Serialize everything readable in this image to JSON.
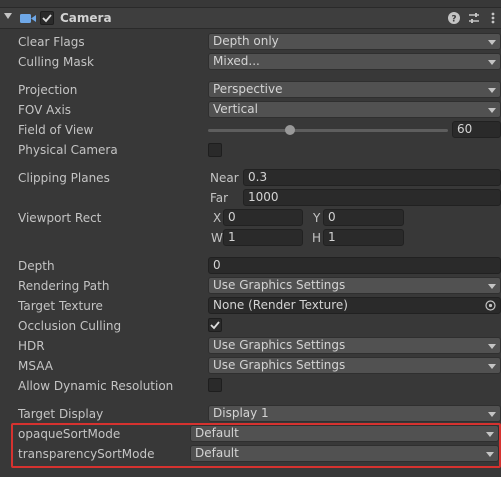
{
  "component": {
    "title": "Camera",
    "enabled": true
  },
  "rows": {
    "clear_flags": {
      "label": "Clear Flags",
      "value": "Depth only"
    },
    "culling_mask": {
      "label": "Culling Mask",
      "value": "Mixed..."
    },
    "projection": {
      "label": "Projection",
      "value": "Perspective"
    },
    "fov_axis": {
      "label": "FOV Axis",
      "value": "Vertical"
    },
    "field_of_view": {
      "label": "Field of View",
      "value": "60"
    },
    "physical_camera": {
      "label": "Physical Camera",
      "checked": false
    },
    "clipping_planes": {
      "label": "Clipping Planes",
      "near_label": "Near",
      "near_value": "0.3",
      "far_label": "Far",
      "far_value": "1000"
    },
    "viewport_rect": {
      "label": "Viewport Rect",
      "x_label": "X",
      "x_value": "0",
      "y_label": "Y",
      "y_value": "0",
      "w_label": "W",
      "w_value": "1",
      "h_label": "H",
      "h_value": "1"
    },
    "depth": {
      "label": "Depth",
      "value": "0"
    },
    "rendering_path": {
      "label": "Rendering Path",
      "value": "Use Graphics Settings"
    },
    "target_texture": {
      "label": "Target Texture",
      "value": "None (Render Texture)"
    },
    "occlusion_culling": {
      "label": "Occlusion Culling",
      "checked": true
    },
    "hdr": {
      "label": "HDR",
      "value": "Use Graphics Settings"
    },
    "msaa": {
      "label": "MSAA",
      "value": "Use Graphics Settings"
    },
    "allow_dynamic_resolution": {
      "label": "Allow Dynamic Resolution",
      "checked": false
    },
    "target_display": {
      "label": "Target Display",
      "value": "Display 1"
    },
    "opaque_sort_mode": {
      "label": "opaqueSortMode",
      "value": "Default"
    },
    "transparency_sort_mode": {
      "label": "transparencySortMode",
      "value": "Default"
    }
  },
  "icons": {
    "foldout": "chevron-down-icon",
    "camera": "camera-icon",
    "help": "help-icon",
    "presets": "presets-icon",
    "menu": "kebab-menu-icon",
    "object_picker": "target-icon",
    "check": "checkmark-icon"
  },
  "colors": {
    "background": "#383838",
    "highlight_border": "#d6322f",
    "camera_icon": "#6fa8e8"
  },
  "field_of_view_slider_fraction": 0.33
}
